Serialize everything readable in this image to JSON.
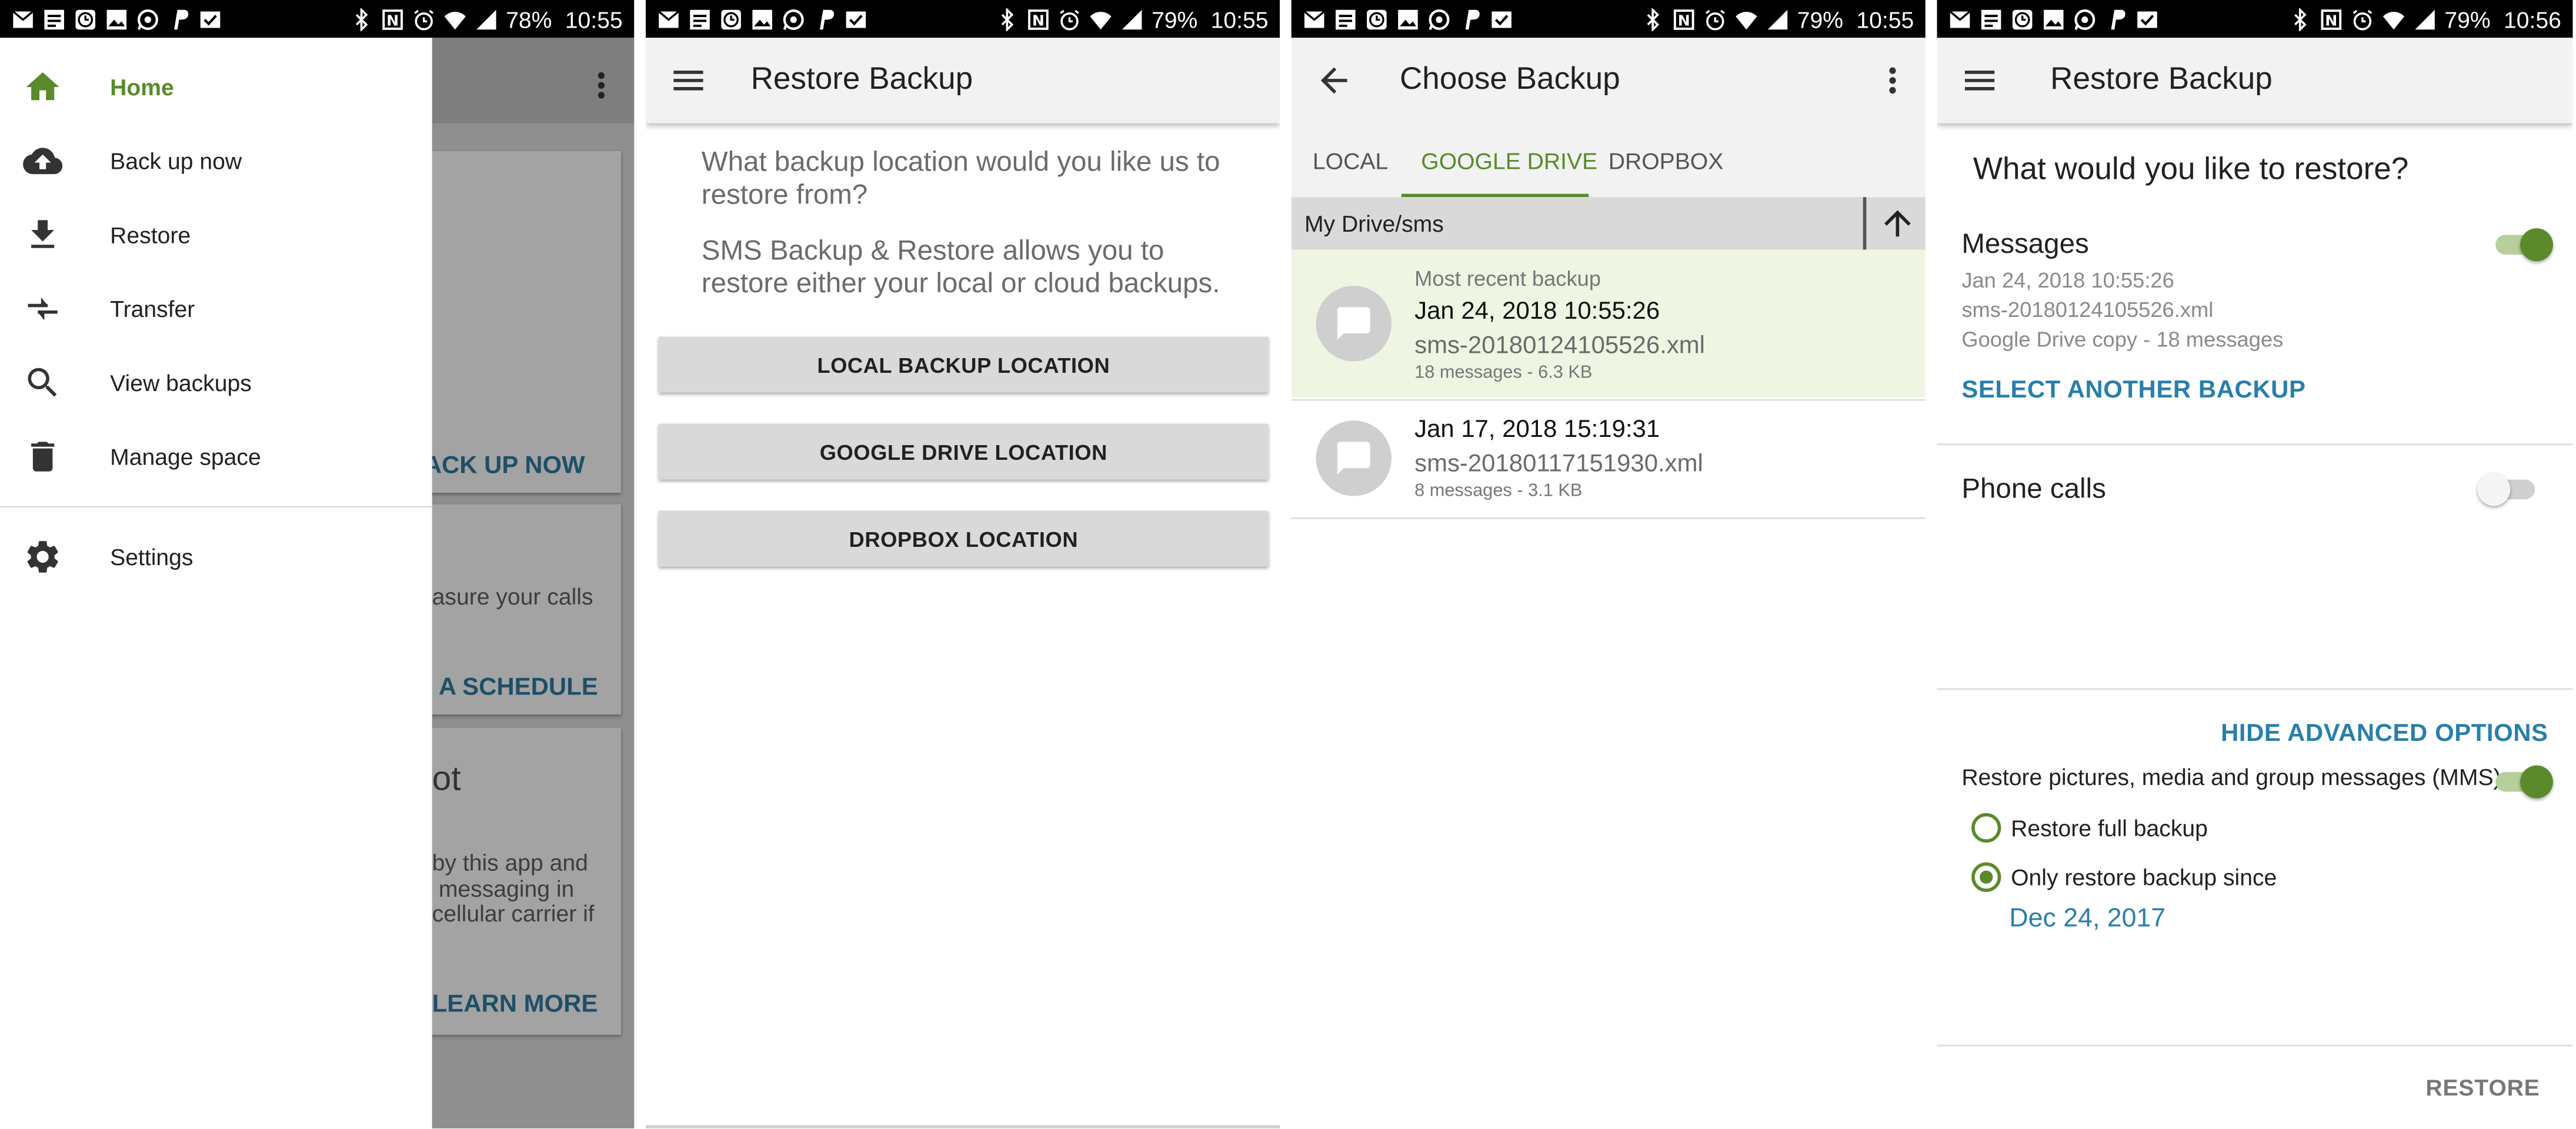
{
  "colors": {
    "accent_green": "#5a8a2a",
    "link_blue": "#2a7fa9",
    "status_bar": "#000000",
    "appbar": "#f2f2f2",
    "highlight_row": "#eff5e3"
  },
  "status_bars": [
    {
      "battery": "78%",
      "time": "10:55"
    },
    {
      "battery": "79%",
      "time": "10:55"
    },
    {
      "battery": "79%",
      "time": "10:55"
    },
    {
      "battery": "79%",
      "time": "10:56"
    }
  ],
  "status_icons_left": [
    "mail-icon",
    "note-icon",
    "clock-app-icon",
    "image-icon",
    "whatsapp-icon",
    "paypal-icon",
    "mail-check-icon"
  ],
  "status_icons_right": [
    "bluetooth-icon",
    "nfc-icon",
    "alarm-icon",
    "wifi-icon",
    "signal-icon"
  ],
  "screen1": {
    "drawer": {
      "items": [
        {
          "label": "Home",
          "icon": "home-icon",
          "active": true
        },
        {
          "label": "Back up now",
          "icon": "cloud-upload-icon"
        },
        {
          "label": "Restore",
          "icon": "download-icon"
        },
        {
          "label": "Transfer",
          "icon": "transfer-icon"
        },
        {
          "label": "View backups",
          "icon": "search-icon"
        },
        {
          "label": "Manage space",
          "icon": "trash-icon"
        },
        {
          "label": "Settings",
          "icon": "gear-icon"
        }
      ]
    },
    "background": {
      "back_up_now": "ACK UP NOW",
      "calls_text": "asure your calls",
      "schedule": "A SCHEDULE",
      "heading": "ot",
      "para1": "by this app and",
      "para2": "l messaging in",
      "para3": "cellular carrier if",
      "learn_more": "LEARN MORE"
    }
  },
  "screen2": {
    "title": "Restore Backup",
    "question": "What backup location would you like us to restore from?",
    "info": "SMS Backup & Restore allows you to restore either your local or cloud backups.",
    "buttons": {
      "local": "LOCAL BACKUP LOCATION",
      "google_drive": "GOOGLE DRIVE LOCATION",
      "dropbox": "DROPBOX LOCATION"
    }
  },
  "screen3": {
    "title": "Choose Backup",
    "tabs": [
      "LOCAL",
      "GOOGLE DRIVE",
      "DROPBOX"
    ],
    "active_tab": 1,
    "path": "My Drive/sms",
    "backups": [
      {
        "tag": "Most recent backup",
        "date": "Jan 24, 2018 10:55:26",
        "file": "sms-20180124105526.xml",
        "details": "18 messages - 6.3 KB"
      },
      {
        "tag": "",
        "date": "Jan 17, 2018 15:19:31",
        "file": "sms-20180117151930.xml",
        "details": "8 messages - 3.1 KB"
      }
    ]
  },
  "screen4": {
    "title": "Restore Backup",
    "heading": "What would you like to restore?",
    "messages": {
      "label": "Messages",
      "enabled": true,
      "date": "Jan 24, 2018 10:55:26",
      "file": "sms-20180124105526.xml",
      "copy": "Google Drive copy - 18 messages",
      "select_another": "SELECT ANOTHER BACKUP"
    },
    "phone_calls": {
      "label": "Phone calls",
      "enabled": false
    },
    "advanced": {
      "toggle_label": "HIDE ADVANCED OPTIONS",
      "mms_label": "Restore pictures, media and group messages (MMS)",
      "mms_enabled": true,
      "radio_full": "Restore full backup",
      "radio_since": "Only restore backup since",
      "selected": "since",
      "since_date": "Dec 24, 2017"
    },
    "restore_button": "RESTORE"
  }
}
